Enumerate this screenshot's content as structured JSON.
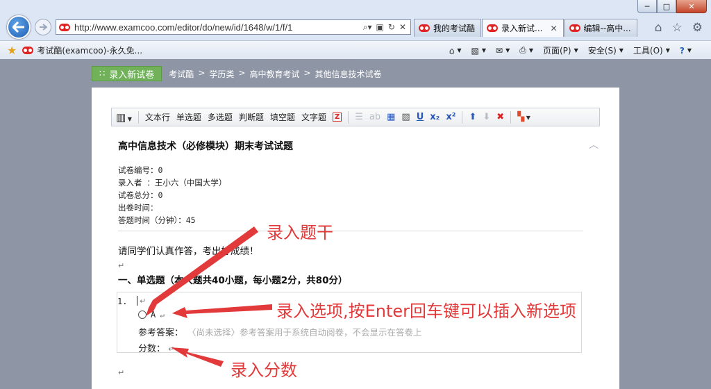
{
  "browser": {
    "url": "http://www.examcoo.com/editor/do/new/id/1648/w/1/f/1",
    "tabs": [
      {
        "label": "我的考试酷",
        "active": false
      },
      {
        "label": "录入新试...",
        "active": true
      },
      {
        "label": "编辑--高中...",
        "active": false
      }
    ],
    "favorite_label": "考试酷(examcoo)-永久免...",
    "commands": {
      "page": "页面(P)",
      "safety": "安全(S)",
      "tools": "工具(O)"
    },
    "window_controls": {
      "minimize": "─",
      "maximize": "□",
      "close": "✕"
    }
  },
  "page": {
    "new_exam_button": "录入新试卷",
    "breadcrumb": [
      "考试酷",
      ">",
      "学历类",
      ">",
      "高中教育考试",
      ">",
      "其他信息技术试卷"
    ]
  },
  "toolbar": {
    "items": [
      "文本行",
      "单选题",
      "多选题",
      "判断题",
      "填空题",
      "文字题"
    ]
  },
  "doc": {
    "title": "高中信息技术（必修模块）期末考试试题",
    "meta": [
      "试卷编号：0",
      "录入者  ：王小六（中国大学）",
      "试卷总分：0",
      "出卷时间：",
      "答题时间（分钟）：45"
    ],
    "intro": "请同学们认真作答，考出好成绩！",
    "section": "一、单选题（本大题共40小题，每小题2分，共80分）",
    "question": {
      "number": "1.",
      "option_label": "A",
      "answer_label": "参考答案：",
      "answer_hint": "〈尚未选择〉参考答案用于系统自动阅卷，不会显示在答卷上",
      "score_label": "分数："
    },
    "para_mark": "↵"
  },
  "annotations": {
    "stem": "录入题干",
    "options": "录入选项,按Enter回车键可以插入新选项",
    "score": "录入分数"
  },
  "colors": {
    "accent_red": "#e23a3a",
    "button_green": "#70b15a",
    "page_bg": "#8e95a4"
  }
}
